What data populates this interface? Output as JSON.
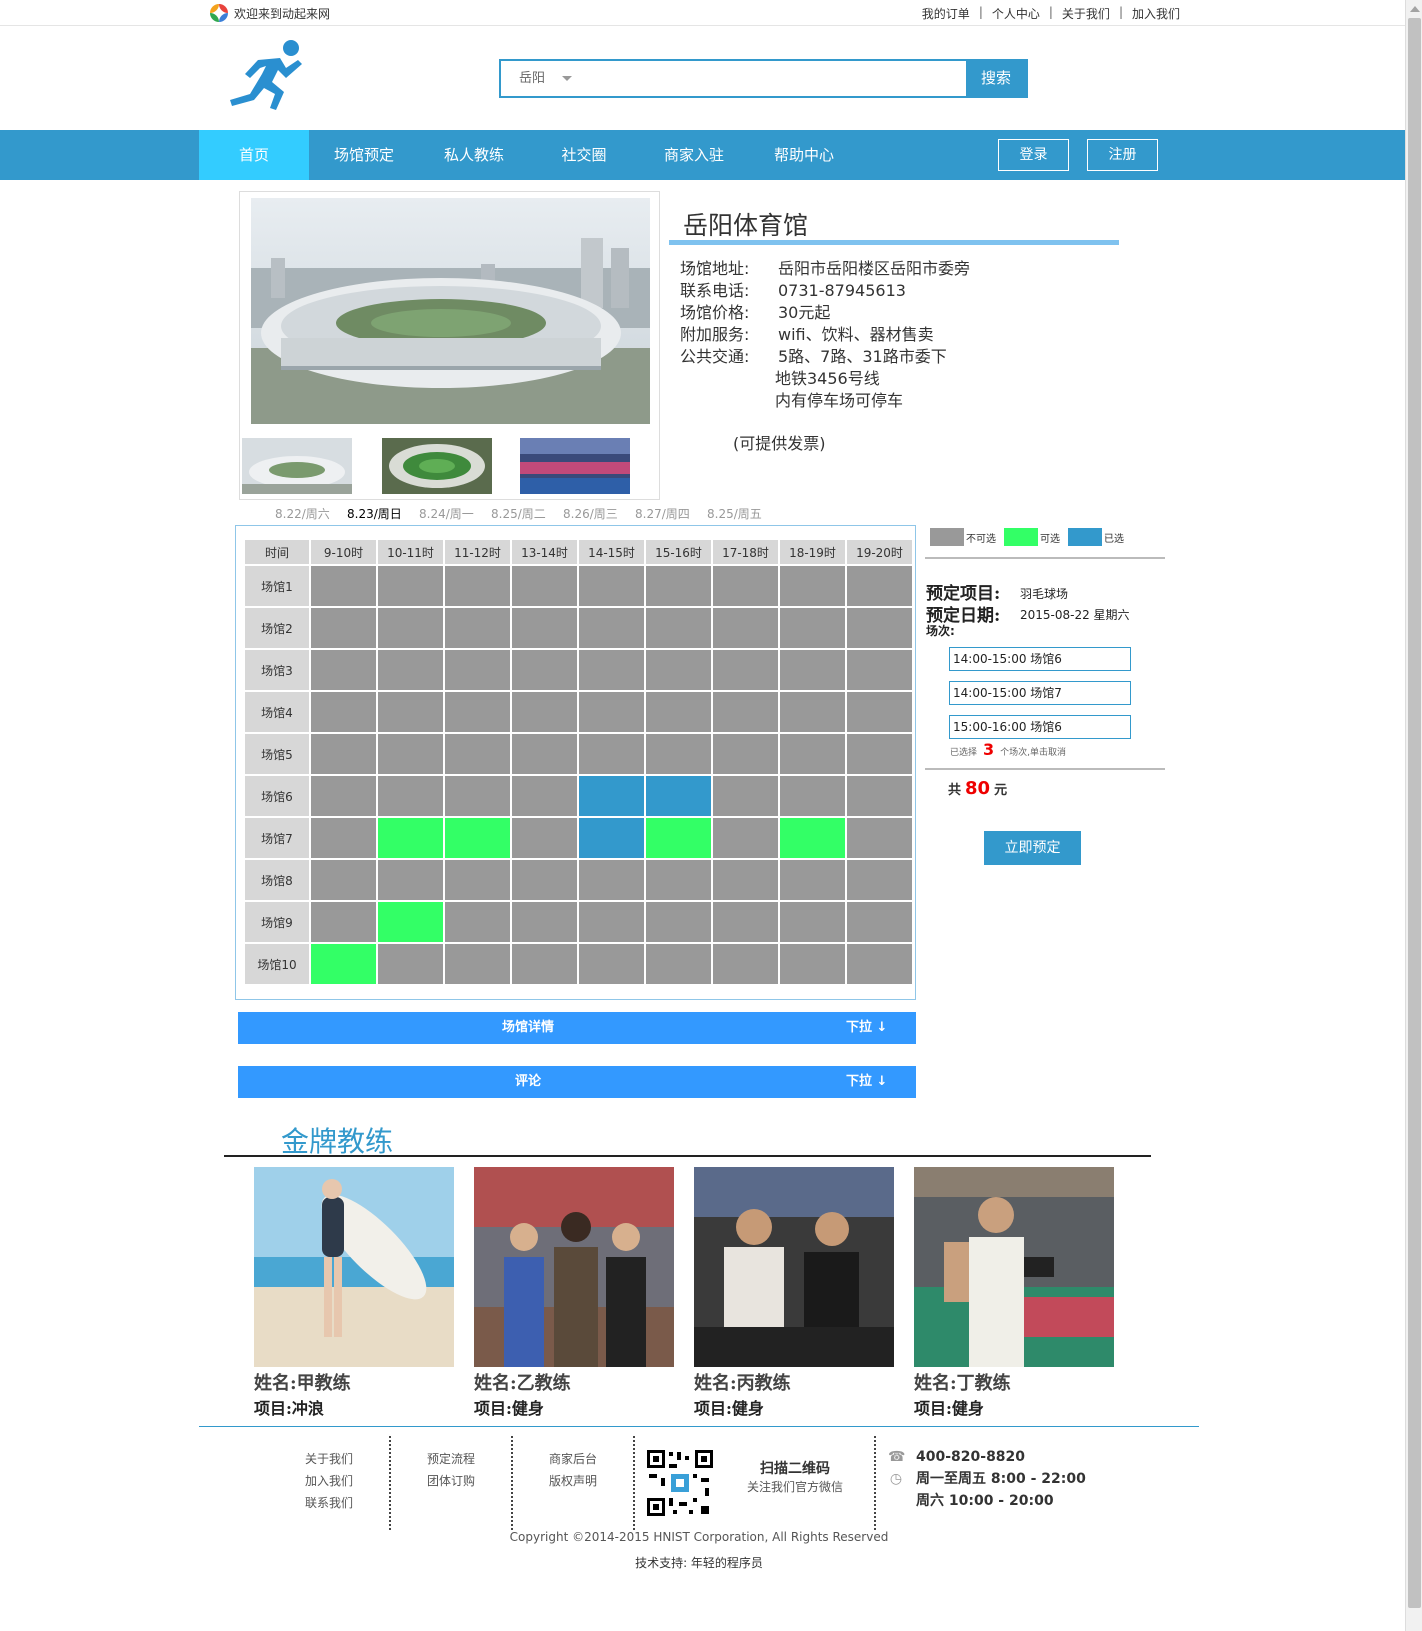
{
  "topbar": {
    "welcome": "欢迎来到动起来网",
    "links": [
      "我的订单",
      "个人中心",
      "关于我们",
      "加入我们"
    ]
  },
  "search": {
    "city": "岳阳",
    "value": "",
    "button": "搜索"
  },
  "nav": {
    "items": [
      "首页",
      "场馆预定",
      "私人教练",
      "社交圈",
      "商家入驻",
      "帮助中心"
    ],
    "active": "首页",
    "login": "登录",
    "register": "注册"
  },
  "venue": {
    "name": "岳阳体育馆",
    "fields": [
      {
        "label": "场馆地址:",
        "value": "岳阳市岳阳楼区岳阳市委旁"
      },
      {
        "label": "联系电话:",
        "value": "0731-87945613"
      },
      {
        "label": "场馆价格:",
        "value": "30元起"
      },
      {
        "label": "附加服务:",
        "value": "wifi、饮料、器材售卖"
      },
      {
        "label": "公共交通:",
        "value": "5路、7路、31路市委下"
      }
    ],
    "transport_extra": [
      "地铁3456号线",
      "内有停车场可停车"
    ],
    "invoice": "(可提供发票)"
  },
  "dates": [
    {
      "label": "8.22/周六",
      "selected": false
    },
    {
      "label": "8.23/周日",
      "selected": true
    },
    {
      "label": "8.24/周一",
      "selected": false
    },
    {
      "label": "8.25/周二",
      "selected": false
    },
    {
      "label": "8.26/周三",
      "selected": false
    },
    {
      "label": "8.27/周四",
      "selected": false
    },
    {
      "label": "8.25/周五",
      "selected": false
    }
  ],
  "schedule": {
    "time_header": "时间",
    "hours": [
      "9-10时",
      "10-11时",
      "11-12时",
      "13-14时",
      "14-15时",
      "15-16时",
      "17-18时",
      "18-19时",
      "19-20时"
    ],
    "courts": [
      "场馆1",
      "场馆2",
      "场馆3",
      "场馆4",
      "场馆5",
      "场馆6",
      "场馆7",
      "场馆8",
      "场馆9",
      "场馆10"
    ],
    "status": [
      [
        "n",
        "n",
        "n",
        "n",
        "n",
        "n",
        "n",
        "n",
        "n"
      ],
      [
        "n",
        "n",
        "n",
        "n",
        "n",
        "n",
        "n",
        "n",
        "n"
      ],
      [
        "n",
        "n",
        "n",
        "n",
        "n",
        "n",
        "n",
        "n",
        "n"
      ],
      [
        "n",
        "n",
        "n",
        "n",
        "n",
        "n",
        "n",
        "n",
        "n"
      ],
      [
        "n",
        "n",
        "n",
        "n",
        "n",
        "n",
        "n",
        "n",
        "n"
      ],
      [
        "n",
        "n",
        "n",
        "n",
        "s",
        "s",
        "n",
        "n",
        "n"
      ],
      [
        "n",
        "a",
        "a",
        "n",
        "s",
        "a",
        "n",
        "a",
        "n"
      ],
      [
        "n",
        "n",
        "n",
        "n",
        "n",
        "n",
        "n",
        "n",
        "n"
      ],
      [
        "n",
        "a",
        "n",
        "n",
        "n",
        "n",
        "n",
        "n",
        "n"
      ],
      [
        "a",
        "n",
        "n",
        "n",
        "n",
        "n",
        "n",
        "n",
        "n"
      ]
    ]
  },
  "legend": {
    "unavailable": "不可选",
    "available": "可选",
    "selected": "已选",
    "colors": {
      "unavailable": "#999999",
      "available": "#33ff66",
      "selected": "#3399cc"
    }
  },
  "booking": {
    "project_label": "预定项目:",
    "project": "羽毛球场",
    "date_label": "预定日期:",
    "date": "2015-08-22 星期六",
    "sessions_label": "场次:",
    "sessions": [
      "14:00-15:00 场馆6",
      "14:00-15:00 场馆7",
      "15:00-16:00 场馆6"
    ],
    "selected_prefix": "已选择",
    "selected_count": "3",
    "selected_suffix": "个场次,单击取消",
    "total_prefix": "共",
    "total": "80",
    "total_unit": "元",
    "submit": "立即预定"
  },
  "dropbars": [
    {
      "title": "场馆详情",
      "action": "下拉 ↓"
    },
    {
      "title": "评论",
      "action": "下拉 ↓"
    }
  ],
  "coaches": {
    "title": "金牌教练",
    "items": [
      {
        "name": "姓名:甲教练",
        "project": "项目:冲浪"
      },
      {
        "name": "姓名:乙教练",
        "project": "项目:健身"
      },
      {
        "name": "姓名:丙教练",
        "project": "项目:健身"
      },
      {
        "name": "姓名:丁教练",
        "project": "项目:健身"
      }
    ]
  },
  "footer": {
    "col1": [
      "关于我们",
      "加入我们",
      "联系我们"
    ],
    "col2": [
      "预定流程",
      "团体订购"
    ],
    "col3": [
      "商家后台",
      "版权声明"
    ],
    "qr_title": "扫描二维码",
    "qr_sub": "关注我们官方微信",
    "phone": "400-820-8820",
    "hours1": "周一至周五  8:00 - 22:00",
    "hours2": "周六  10:00 - 20:00",
    "copyright": "Copyright ©2014-2015 HNIST Corporation, All Rights Reserved",
    "support": "技术支持:   年轻的程序员"
  },
  "icons": [
    "pinwheel-logo-icon",
    "runner-logo-icon",
    "phone-icon",
    "clock-icon",
    "qr-code-icon",
    "arrow-down-icon"
  ]
}
